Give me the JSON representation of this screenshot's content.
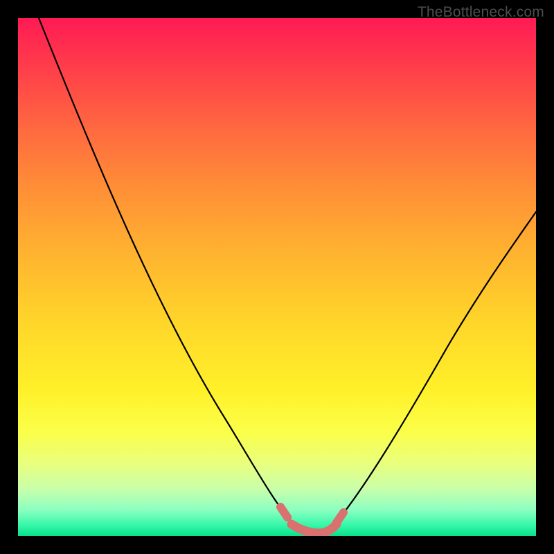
{
  "watermark": "TheBottleneck.com",
  "chart_data": {
    "type": "line",
    "title": "",
    "xlabel": "",
    "ylabel": "",
    "xlim": [
      0,
      100
    ],
    "ylim": [
      0,
      100
    ],
    "series": [
      {
        "name": "left-curve",
        "x": [
          4,
          10,
          16,
          22,
          28,
          34,
          40,
          46,
          50,
          53
        ],
        "y": [
          100,
          86,
          73,
          60,
          47,
          35,
          23,
          12,
          5,
          1
        ]
      },
      {
        "name": "right-curve",
        "x": [
          61,
          65,
          70,
          76,
          82,
          88,
          94,
          100
        ],
        "y": [
          1,
          5,
          12,
          22,
          33,
          44,
          54,
          63
        ]
      },
      {
        "name": "bottom-highlight",
        "x": [
          50,
          53,
          56,
          59,
          61
        ],
        "y": [
          2,
          0.5,
          0.5,
          0.5,
          2
        ]
      }
    ],
    "highlight_color": "#d9716f",
    "curve_color": "#000000"
  }
}
